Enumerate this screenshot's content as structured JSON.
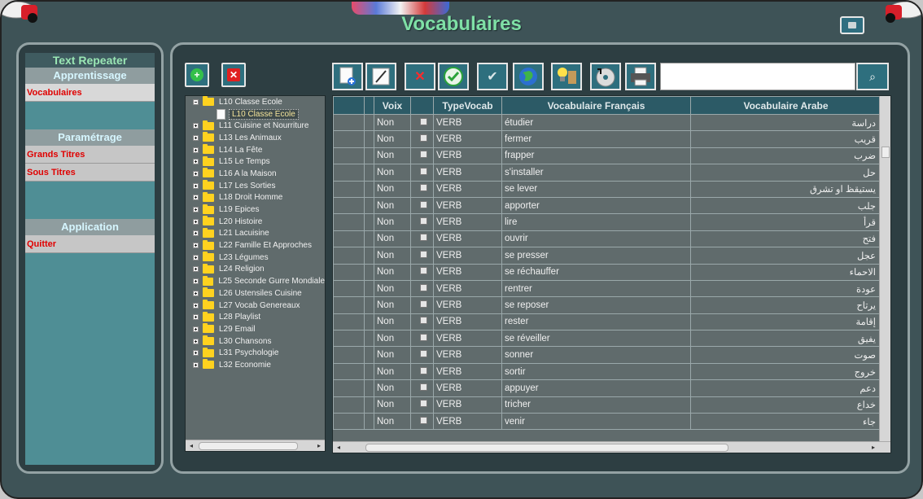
{
  "window": {
    "title": "Vocabulaires"
  },
  "sidebar": {
    "app_name": "Text Repeater",
    "section_apprentissage": "Apprentissage",
    "item_vocabulaires": "Vocabulaires",
    "section_parametrage": "Paramétrage",
    "item_grands_titres": "Grands Titres",
    "item_sous_titres": "Sous Titres",
    "section_application": "Application",
    "item_quitter": "Quitter"
  },
  "tree": {
    "root_label": "L10 Classe Ecole",
    "child_label": "L10 Classe Ecole",
    "nodes": [
      "L11 Cuisine et Nourriture",
      "L13 Les Animaux",
      "L14 La Fête",
      "L15 Le Temps",
      "L16 A la Maison",
      "L17 Les Sorties",
      "L18 Droit Homme",
      "L19 Epices",
      "L20 Histoire",
      "L21 Lacuisine",
      "L22 Famille Et Approches",
      "L23 Légumes",
      "L24 Religion",
      "L25 Seconde Gurre Mondiale",
      "L26 Ustensiles Cuisine",
      "L27 Vocab Genereaux",
      "L28 Playlist",
      "L29 Email",
      "L30 Chansons",
      "L31 Psychologie",
      "L32 Economie"
    ]
  },
  "search": {
    "value": "",
    "placeholder": ""
  },
  "grid": {
    "columns": {
      "voix": "Voix",
      "type": "TypeVocab",
      "fr": "Vocabulaire Français",
      "ar": "Vocabulaire Arabe"
    },
    "rows": [
      {
        "voix": "Non",
        "type": "VERB",
        "fr": "étudier",
        "ar": "دراسة"
      },
      {
        "voix": "Non",
        "type": "VERB",
        "fr": "fermer",
        "ar": "قريب"
      },
      {
        "voix": "Non",
        "type": "VERB",
        "fr": "frapper",
        "ar": "ضرب"
      },
      {
        "voix": "Non",
        "type": "VERB",
        "fr": "s'installer",
        "ar": "حل"
      },
      {
        "voix": "Non",
        "type": "VERB",
        "fr": "se lever",
        "ar": "يستيقظ او تشرق"
      },
      {
        "voix": "Non",
        "type": "VERB",
        "fr": "apporter",
        "ar": "جلب"
      },
      {
        "voix": "Non",
        "type": "VERB",
        "fr": "lire",
        "ar": "قرأ"
      },
      {
        "voix": "Non",
        "type": "VERB",
        "fr": "ouvrir",
        "ar": "فتح"
      },
      {
        "voix": "Non",
        "type": "VERB",
        "fr": "se presser",
        "ar": "عجل"
      },
      {
        "voix": "Non",
        "type": "VERB",
        "fr": "se réchauffer",
        "ar": "الاحماء"
      },
      {
        "voix": "Non",
        "type": "VERB",
        "fr": "rentrer",
        "ar": "عودة"
      },
      {
        "voix": "Non",
        "type": "VERB",
        "fr": "se reposer",
        "ar": "يرتاح"
      },
      {
        "voix": "Non",
        "type": "VERB",
        "fr": "rester",
        "ar": "إقامة"
      },
      {
        "voix": "Non",
        "type": "VERB",
        "fr": "se réveiller",
        "ar": "يفيق"
      },
      {
        "voix": "Non",
        "type": "VERB",
        "fr": "sonner",
        "ar": "صوت"
      },
      {
        "voix": "Non",
        "type": "VERB",
        "fr": "sortir",
        "ar": "خروج"
      },
      {
        "voix": "Non",
        "type": "VERB",
        "fr": "appuyer",
        "ar": "دعم"
      },
      {
        "voix": "Non",
        "type": "VERB",
        "fr": "tricher",
        "ar": "خداع"
      },
      {
        "voix": "Non",
        "type": "VERB",
        "fr": "venir",
        "ar": "جاء"
      }
    ]
  },
  "colors": {
    "window_bg": "#3e5357",
    "title": "#7fe0a6",
    "sidebar_panel": "#4f8e95",
    "menu_item_text": "#e00000",
    "grid_header": "#2c5a66",
    "button_bg": "#2e6f7e"
  }
}
